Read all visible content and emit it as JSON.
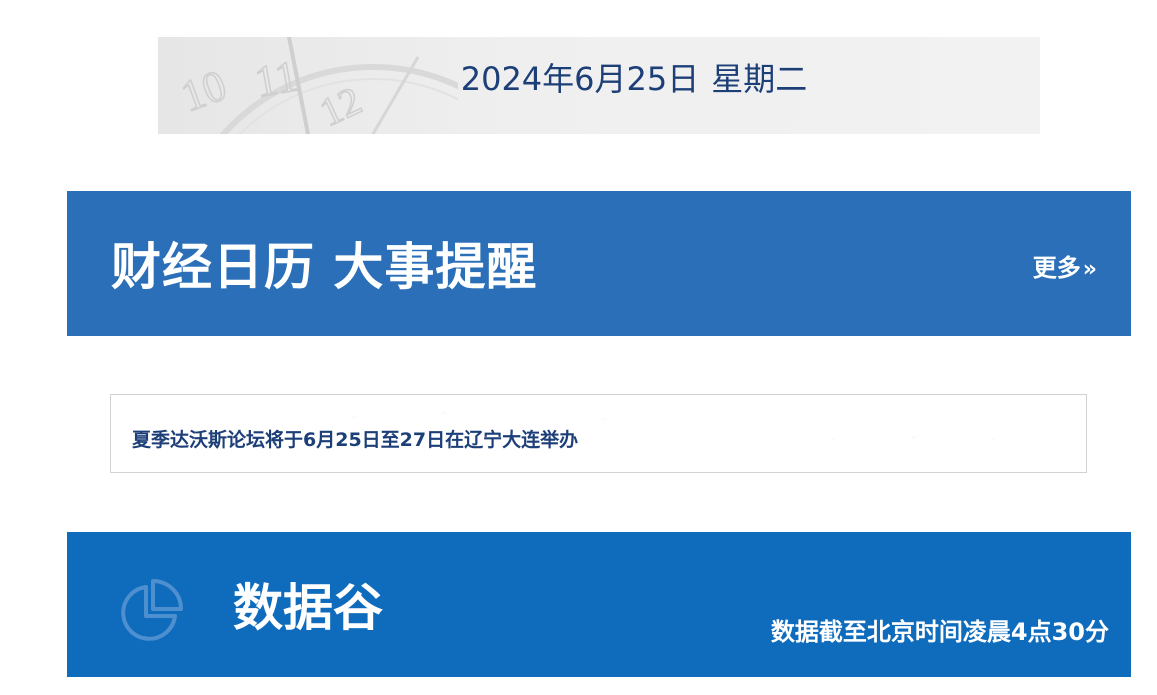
{
  "date_banner": {
    "date": "2024年6月25日",
    "weekday": "星期二",
    "clock_numerals": [
      "10",
      "11",
      "12"
    ]
  },
  "calendar_section": {
    "title": "财经日历 大事提醒",
    "more_label": "更多",
    "more_icon": "double-chevron-right-icon",
    "color": "#2a6fb8"
  },
  "events": [
    {
      "text": "夏季达沃斯论坛将于6月25日至27日在辽宁大连举办"
    }
  ],
  "data_section": {
    "title": "数据谷",
    "note": "数据截至北京时间凌晨4点30分",
    "icon": "pie-chart-icon",
    "color": "#0f6cbd"
  },
  "colors": {
    "text_dark_blue": "#1d3f78",
    "banner_gray": "#efefef"
  }
}
